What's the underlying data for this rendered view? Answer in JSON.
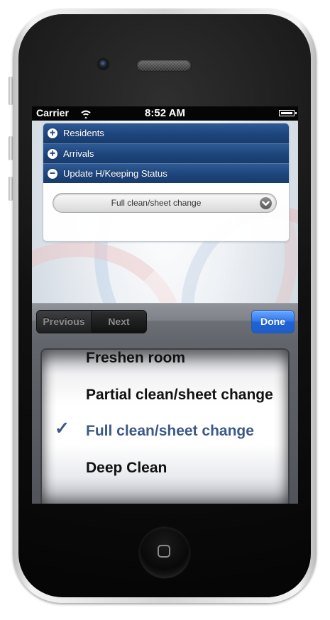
{
  "status_bar": {
    "carrier": "Carrier",
    "time": "8:52 AM",
    "wifi_icon": "wifi-icon",
    "battery_icon": "battery-icon"
  },
  "accordion": {
    "sections": [
      {
        "label": "Residents",
        "icon": "plus-icon"
      },
      {
        "label": "Arrivals",
        "icon": "plus-icon"
      },
      {
        "label": "Update H/Keeping Status",
        "icon": "minus-icon"
      }
    ],
    "select_value": "Full clean/sheet change",
    "select_icon": "chevron-down-icon"
  },
  "toolbar": {
    "previous": "Previous",
    "next": "Next",
    "done": "Done"
  },
  "picker": {
    "items": [
      "Freshen room",
      "Partial clean/sheet change",
      "Full clean/sheet change",
      "Deep Clean"
    ],
    "selected": "Full clean/sheet change",
    "check_icon": "checkmark-icon"
  },
  "colors": {
    "header_blue": "#1e467e",
    "done_blue": "#2f79ef",
    "selected_text": "#3d5a86"
  }
}
